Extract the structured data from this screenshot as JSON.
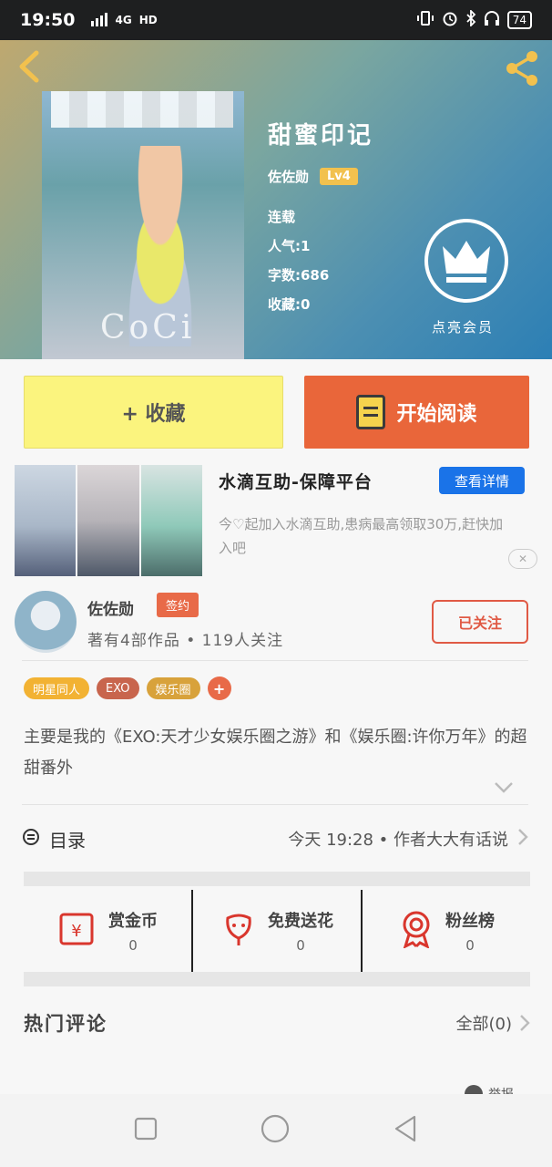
{
  "status_bar": {
    "time": "19:50",
    "signal": "4G",
    "hd": "HD",
    "battery": "74"
  },
  "book": {
    "title": "甜蜜印记",
    "author": "佐佐勋",
    "level": "Lv4",
    "status": "连载",
    "popularity": "人气:1",
    "word_count": "字数:686",
    "favorites": "收藏:0",
    "cover_watermark": "CoCi"
  },
  "vip": {
    "label": "点亮会员"
  },
  "actions": {
    "favorite_label": "+ 收藏",
    "read_label": "开始阅读"
  },
  "ad": {
    "title": "水滴互助-保障平台",
    "button": "查看详情",
    "description": "今♡起加入水滴互助,患病最高领取30万,赶快加入吧",
    "close": "✕"
  },
  "author_card": {
    "name": "佐佐勋",
    "badge": "签约",
    "stats": "著有4部作品 • 119人关注",
    "follow_label": "已关注"
  },
  "tags": [
    {
      "label": "明星同人",
      "color": "#f2b233"
    },
    {
      "label": "EXO",
      "color": "#c8654d"
    },
    {
      "label": "娱乐圈",
      "color": "#d8a23b"
    }
  ],
  "tag_add": "+",
  "summary": "主要是我的《EXO:天才少女娱乐圈之游》和《娱乐圈:许你万年》的超甜番外",
  "toc": {
    "label": "目录",
    "update": "今天 19:28 • 作者大大有话说"
  },
  "stats": [
    {
      "label": "赏金币",
      "count": "0",
      "icon": "coin-envelope-icon"
    },
    {
      "label": "免费送花",
      "count": "0",
      "icon": "flower-icon"
    },
    {
      "label": "粉丝榜",
      "count": "0",
      "icon": "medal-icon"
    }
  ],
  "comments": {
    "title": "热门评论",
    "all": "全部(0)"
  },
  "bottom_peek": {
    "text": "举报"
  },
  "colors": {
    "accent_orange": "#e9663a",
    "fav_yellow": "#fbf47e",
    "ad_blue": "#1a73e8",
    "follow_red": "#e05a45"
  }
}
